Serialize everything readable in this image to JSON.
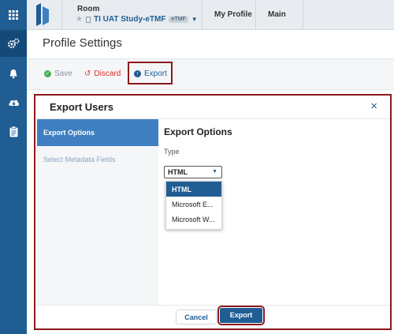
{
  "header": {
    "room_label": "Room",
    "study_name": "TI UAT Study-eTMF",
    "study_badge": "eTMF",
    "breadcrumbs": [
      "My Profile",
      "Main"
    ]
  },
  "page": {
    "title": "Profile Settings"
  },
  "toolbar": {
    "save_label": "Save",
    "discard_label": "Discard",
    "export_label": "Export"
  },
  "modal": {
    "title": "Export Users",
    "close_glyph": "×",
    "sidebar": [
      "Export Options",
      "Select Metadata Fields"
    ],
    "section_title": "Export Options",
    "type_label": "Type",
    "type_value": "HTML",
    "type_options": [
      "HTML",
      "Microsoft E...",
      "Microsoft W..."
    ],
    "cancel_label": "Cancel",
    "export_label": "Export"
  },
  "icons": {
    "apps": "grid-icon",
    "settings": "gears-icon",
    "notifications": "bell-icon",
    "download": "cloud-download-icon",
    "tasks": "clipboard-icon"
  },
  "colors": {
    "brand": "#1f5d93",
    "active_sidebar": "#3f7fc1",
    "highlight": "#8b1a1a",
    "save_green": "#4caf50",
    "discard_red": "#d9342b"
  }
}
